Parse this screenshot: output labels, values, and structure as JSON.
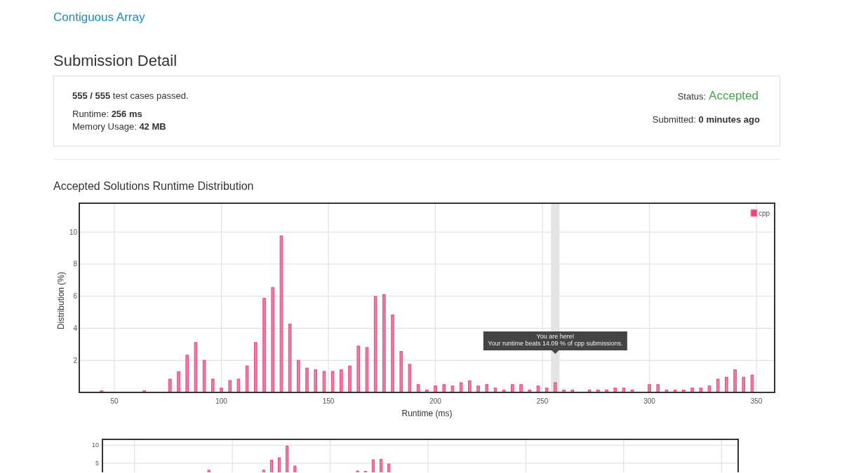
{
  "problem_link": "Contiguous Array",
  "page_title": "Submission Detail",
  "summary": {
    "test_cases": "**555 / 555** test cases passed.",
    "runtime": "Runtime: **256 ms**",
    "memory": "Memory Usage: **42 MB**",
    "status": {
      "label": "Status:",
      "value": "Accepted",
      "kind": "accepted"
    },
    "submitted": "Submitted: **0 minutes ago**"
  },
  "distribution": {
    "title": "Accepted Solutions Runtime Distribution",
    "chart_data": {
      "type": "bar",
      "xlabel": "Runtime (ms)",
      "ylabel": "Distribution (%)",
      "x": [
        44,
        64,
        76,
        80,
        84,
        88,
        92,
        96,
        100,
        104,
        108,
        112,
        116,
        120,
        124,
        128,
        132,
        136,
        140,
        144,
        148,
        152,
        156,
        160,
        164,
        168,
        172,
        176,
        180,
        184,
        188,
        192,
        196,
        200,
        204,
        208,
        212,
        216,
        220,
        224,
        228,
        232,
        236,
        240,
        244,
        248,
        252,
        256,
        260,
        264,
        272,
        276,
        280,
        284,
        288,
        292,
        300,
        304,
        308,
        312,
        316,
        320,
        324,
        328,
        332,
        336,
        340,
        344,
        348
      ],
      "series": [
        {
          "name": "cpp",
          "color": "#e8457a",
          "values": [
            0.1,
            0.1,
            0.83,
            1.29,
            2.32,
            3.11,
            2.0,
            0.83,
            0.27,
            0.74,
            0.83,
            1.65,
            3.11,
            5.87,
            6.54,
            9.76,
            4.26,
            2.0,
            1.52,
            1.41,
            1.31,
            1.31,
            1.41,
            1.65,
            2.89,
            2.8,
            5.99,
            6.1,
            4.83,
            2.55,
            1.75,
            0.49,
            0.15,
            0.4,
            0.49,
            0.4,
            0.61,
            0.72,
            0.4,
            0.49,
            0.27,
            0.15,
            0.49,
            0.49,
            0.15,
            0.4,
            0.27,
            0.61,
            0.15,
            0.15,
            0.15,
            0.15,
            0.15,
            0.27,
            0.27,
            0.15,
            0.49,
            0.49,
            0.15,
            0.15,
            0.15,
            0.27,
            0.27,
            0.4,
            0.83,
            0.95,
            1.41,
            0.95,
            1.08
          ]
        }
      ],
      "xlim": [
        33.6,
        358.5
      ],
      "ylim": [
        0,
        11.8
      ],
      "xticks": [
        50,
        100,
        150,
        200,
        250,
        300,
        350
      ],
      "yticks": [
        2,
        4,
        6,
        8,
        10
      ],
      "grid": true,
      "bands": [
        {
          "axis": "x",
          "from": 254,
          "to": 258
        }
      ],
      "annotations": [
        "You are here!",
        "Your runtime beats 14.09 % of cpp submissions."
      ]
    }
  },
  "overview": {
    "y_tick_labels": [
      "10",
      "5"
    ]
  }
}
